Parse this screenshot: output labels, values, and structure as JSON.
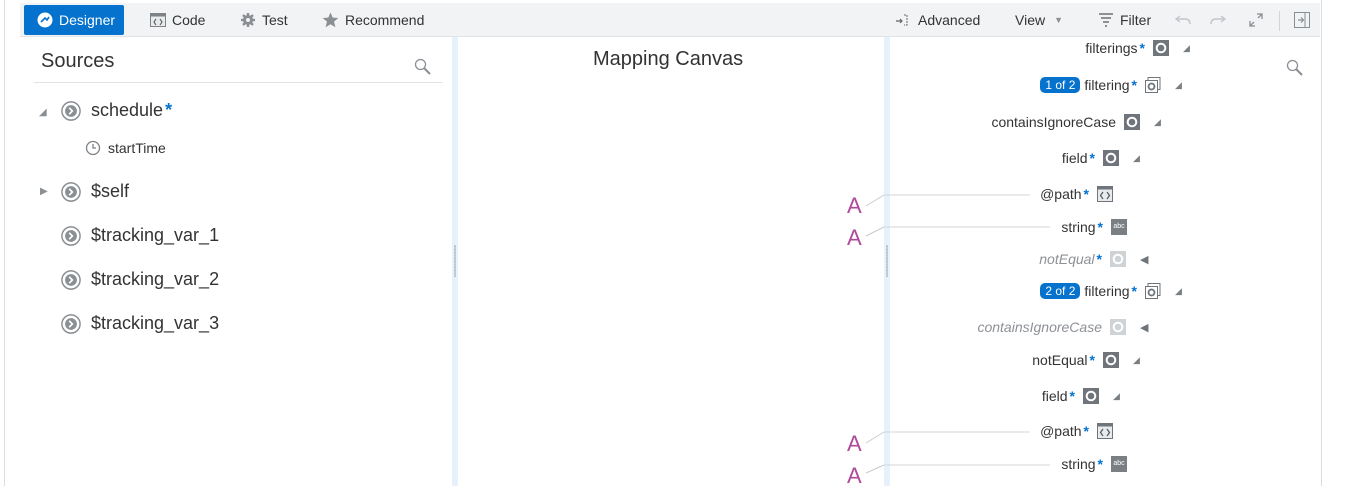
{
  "toolbar": {
    "tabs": [
      {
        "label": "Designer",
        "icon": "designer-icon",
        "active": true
      },
      {
        "label": "Code",
        "icon": "code-icon"
      },
      {
        "label": "Test",
        "icon": "gear-icon"
      },
      {
        "label": "Recommend",
        "icon": "star-icon"
      }
    ],
    "advanced_label": "Advanced",
    "view_label": "View",
    "filter_label": "Filter"
  },
  "colors": {
    "accent": "#0572ce",
    "literal": "#b0499a",
    "splitter": "#e6f1fb"
  },
  "sources": {
    "title": "Sources",
    "items": [
      {
        "label": "schedule",
        "required": "*",
        "expanded": true
      },
      {
        "label": "startTime",
        "child": true
      },
      {
        "label": "$self",
        "expanded": false
      },
      {
        "label": "$tracking_var_1"
      },
      {
        "label": "$tracking_var_2"
      },
      {
        "label": "$tracking_var_3"
      }
    ]
  },
  "canvas": {
    "title": "Mapping Canvas",
    "literal_glyph": "A"
  },
  "target": {
    "rows": [
      {
        "label": "filterings",
        "star": "*",
        "icon": "element-icon"
      },
      {
        "label": "filtering",
        "star": "*",
        "badge": "1 of 2",
        "icon": "repeat-element-icon"
      },
      {
        "label": "containsIgnoreCase",
        "icon": "element-icon"
      },
      {
        "label": "field",
        "star": "*",
        "icon": "element-icon"
      },
      {
        "label": "@path",
        "star": "*",
        "icon": "attribute-icon"
      },
      {
        "label": "string",
        "star": "*",
        "icon": "string-icon",
        "icon_text": "abc"
      },
      {
        "label": "notEqual",
        "star": "*",
        "icon": "element-icon"
      },
      {
        "label": "filtering",
        "star": "*",
        "badge": "2 of 2",
        "icon": "repeat-element-icon"
      },
      {
        "label": "containsIgnoreCase",
        "icon": "element-icon"
      },
      {
        "label": "notEqual",
        "star": "*",
        "icon": "element-icon"
      },
      {
        "label": "field",
        "star": "*",
        "icon": "element-icon"
      },
      {
        "label": "@path",
        "star": "*",
        "icon": "attribute-icon"
      },
      {
        "label": "string",
        "star": "*",
        "icon": "string-icon",
        "icon_text": "abc"
      }
    ]
  }
}
